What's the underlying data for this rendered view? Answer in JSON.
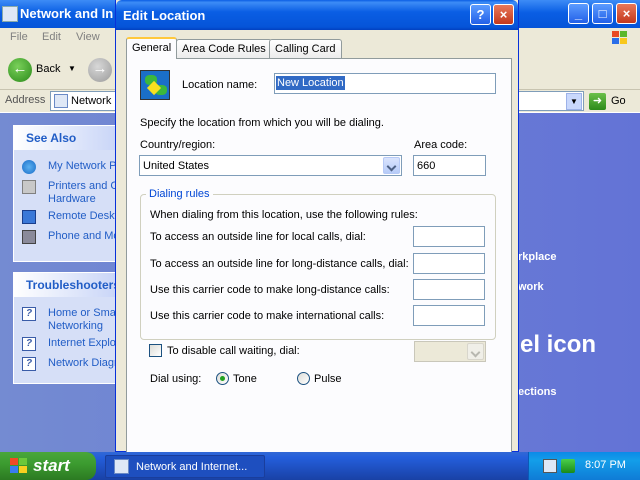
{
  "background_window": {
    "title": "Network and Internet Connections",
    "title_visible": "Network and In",
    "menu": [
      "File",
      "Edit",
      "View"
    ],
    "back_label": "Back",
    "address_label": "Address",
    "address_value": "Network and Internet Connections",
    "address_visible": "Network",
    "go_label": "Go",
    "see_also": {
      "header": "See Also",
      "items": [
        "My Network P",
        "Printers and Other Hardware",
        "Remote Deskt",
        "Phone and Mo"
      ],
      "items_visible": [
        "My Network P",
        "Printers and C",
        "Hardware",
        "Remote Deskt",
        "Phone and Mo"
      ]
    },
    "troubleshooters": {
      "header": "Troubleshooters",
      "items_visible": [
        "Home or Small",
        "Networking",
        "Internet Explo",
        "Network Diagn"
      ]
    },
    "main_text": [
      "rkplace",
      "work",
      "el icon",
      "ections"
    ]
  },
  "taskbar": {
    "start_label": "start",
    "task_item_label": "Network and Internet...",
    "clock": "8:07 PM"
  },
  "dialog": {
    "title": "Edit Location",
    "help_symbol": "?",
    "close_symbol": "×",
    "tabs": [
      {
        "label": "General",
        "active": true
      },
      {
        "label": "Area Code Rules",
        "active": false
      },
      {
        "label": "Calling Card",
        "active": false
      }
    ],
    "location_name_label": "Location name:",
    "location_name_value": "New Location",
    "specify_text": "Specify the location from which you will be dialing.",
    "country_label": "Country/region:",
    "country_value": "United States",
    "area_code_label": "Area code:",
    "area_code_value": "660",
    "dialing_rules": {
      "legend": "Dialing rules",
      "intro": "When dialing from this location, use the following rules:",
      "rules": [
        {
          "label": "To access an outside line for local calls, dial:",
          "value": ""
        },
        {
          "label": "To access an outside line for long-distance calls, dial:",
          "value": ""
        },
        {
          "label": "Use this carrier code to make long-distance calls:",
          "value": ""
        },
        {
          "label": "Use this carrier code to make international calls:",
          "value": ""
        }
      ]
    },
    "call_waiting_label": "To disable call waiting, dial:",
    "call_waiting_checked": false,
    "dial_using_label": "Dial using:",
    "dial_options": [
      {
        "label": "Tone",
        "selected": true
      },
      {
        "label": "Pulse",
        "selected": false
      }
    ]
  },
  "colors": {
    "title_blue": "#0a5ee4",
    "dialog_face": "#ece9d8",
    "start_green": "#3c9c30",
    "selection_blue": "#316ac5",
    "group_label_blue": "#0046d5"
  }
}
